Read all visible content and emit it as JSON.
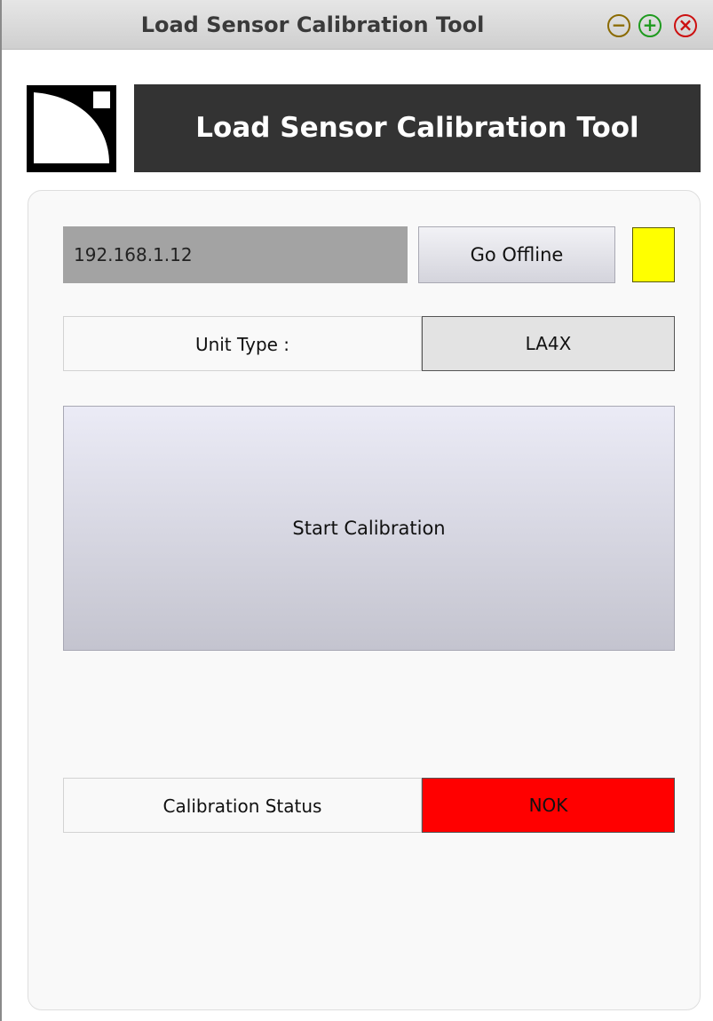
{
  "window": {
    "title": "Load Sensor Calibration Tool",
    "controls": {
      "minimize_icon": "minus-circle-icon",
      "maximize_icon": "plus-circle-icon",
      "close_icon": "x-circle-icon",
      "minimize_glyph": "−",
      "maximize_glyph": "+",
      "close_glyph": "×"
    }
  },
  "header": {
    "logo_icon": "brand-logo",
    "title": "Load Sensor Calibration Tool"
  },
  "connection": {
    "ip_address": "192.168.1.12",
    "toggle_label": "Go Offline",
    "indicator_color": "#ffff00"
  },
  "unit": {
    "label": "Unit Type :",
    "value": "LA4X"
  },
  "actions": {
    "start_label": "Start Calibration"
  },
  "calibration": {
    "label": "Calibration Status",
    "value": "NOK",
    "value_color": "#ff0000"
  },
  "colors": {
    "header_bg": "#333333",
    "titlebar_bg": "#d9d9d9"
  }
}
